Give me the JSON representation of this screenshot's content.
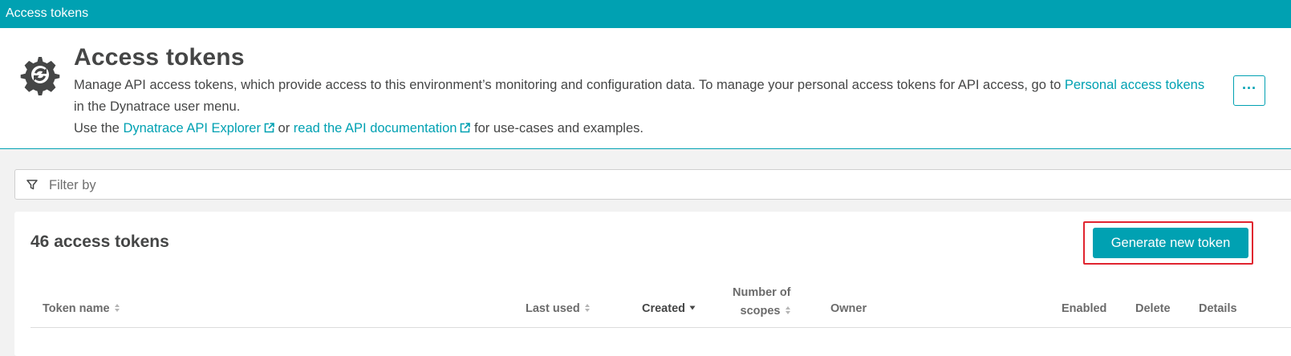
{
  "topbar": {
    "title": "Access tokens"
  },
  "header": {
    "title": "Access tokens",
    "desc_line1_pre": "Manage API access tokens, which provide access to this environment’s monitoring and configuration data. To manage your personal access tokens for API access, go to ",
    "personal_link": "Personal access tokens",
    "desc_line1_post": " in the Dynatrace user menu.",
    "desc_line2_pre": "Use the ",
    "api_explorer_link": "Dynatrace API Explorer",
    "desc_or": " or ",
    "api_docs_link": "read the API documentation",
    "desc_line2_post": " for use-cases and examples.",
    "more_label": "···"
  },
  "filter": {
    "placeholder": "Filter by"
  },
  "panel": {
    "count_title": "46 access tokens",
    "generate_label": "Generate new token"
  },
  "table": {
    "columns": {
      "token_name": "Token name",
      "last_used": "Last used",
      "created": "Created",
      "scopes_line1": "Number of",
      "scopes_line2": "scopes",
      "owner": "Owner",
      "enabled": "Enabled",
      "delete": "Delete",
      "details": "Details"
    }
  },
  "colors": {
    "accent": "#00a1b2",
    "highlight": "#e0242f",
    "text": "#454646"
  }
}
